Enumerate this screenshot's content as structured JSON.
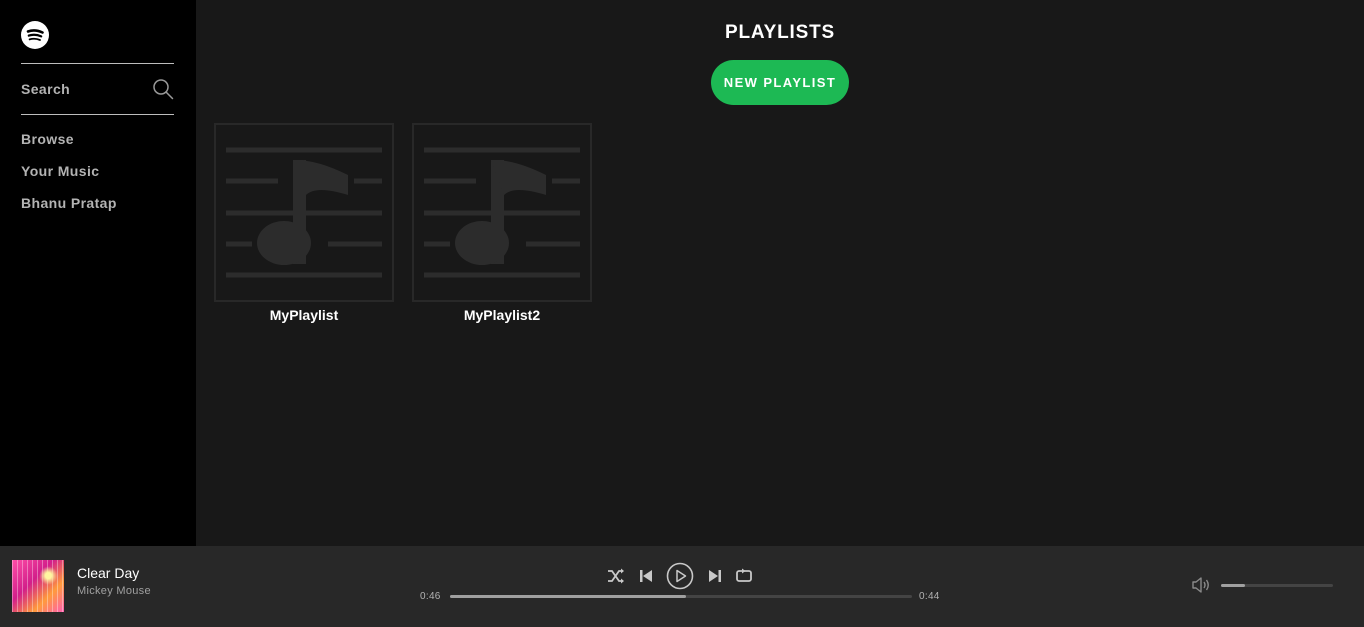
{
  "sidebar": {
    "logo_icon": "spotify-logo",
    "search_label": "Search",
    "search_icon": "search-icon",
    "nav": [
      {
        "label": "Browse"
      },
      {
        "label": "Your Music"
      },
      {
        "label": "Bhanu Pratap"
      }
    ]
  },
  "main": {
    "title": "PLAYLISTS",
    "new_playlist_label": "NEW PLAYLIST",
    "playlists": [
      {
        "name": "MyPlaylist",
        "art_icon": "music-note-list-icon"
      },
      {
        "name": "MyPlaylist2",
        "art_icon": "music-note-list-icon"
      }
    ]
  },
  "player": {
    "track_name": "Clear Day",
    "artist_name": "Mickey Mouse",
    "time_elapsed": "0:46",
    "time_remaining": "0:44",
    "progress_fraction": 0.51,
    "volume_fraction": 0.21,
    "controls": [
      "shuffle-icon",
      "previous-icon",
      "play-icon",
      "next-icon",
      "repeat-icon"
    ],
    "volume_icon": "volume-icon"
  },
  "colors": {
    "accent": "#1db954",
    "sidebar_bg": "#000000",
    "main_bg": "#181818",
    "player_bg": "#282828"
  }
}
